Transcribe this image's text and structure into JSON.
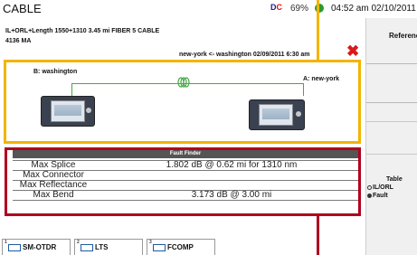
{
  "titlebar": {
    "app_title": "CABLE",
    "battery_percent": "69%",
    "clock": "04:52 am 02/10/2011"
  },
  "header": {
    "line1": "IL+ORL+Length 1550+1310 3.45 mi  FIBER 5   CABLE",
    "line2": "4136 MA",
    "line3": "new-york <- washington    02/09/2011    6:30 am"
  },
  "link": {
    "end_b": "B: washington",
    "end_a": "A: new-york"
  },
  "fault_finder": {
    "title": "Fault Finder",
    "rows": [
      {
        "label": "Max Splice",
        "value": "1.802 dB @ 0.62 mi for 1310 nm"
      },
      {
        "label": "Max Connector",
        "value": ""
      },
      {
        "label": "Max Reflectance",
        "value": ""
      },
      {
        "label": "Max Bend",
        "value": "3.173 dB @ 3.00 mi"
      }
    ]
  },
  "tabs": [
    {
      "num": "1",
      "label": "SM-OTDR"
    },
    {
      "num": "2",
      "label": "LTS"
    },
    {
      "num": "3",
      "label": "FCOMP"
    }
  ],
  "sidebar": {
    "title": "References",
    "table_title": "Table",
    "options": [
      {
        "label": "IL/ORL",
        "selected": false
      },
      {
        "label": "Fault",
        "selected": true
      }
    ]
  },
  "colors": {
    "highlight_yellow": "#f2b400",
    "highlight_red": "#b00020",
    "fiber_green": "#46a846",
    "close_red": "#d81a1a"
  },
  "icons": [
    "dc-icon",
    "battery-icon",
    "close-icon",
    "fiber-coil-icon",
    "otdr-device-icon",
    "tab-icon"
  ]
}
